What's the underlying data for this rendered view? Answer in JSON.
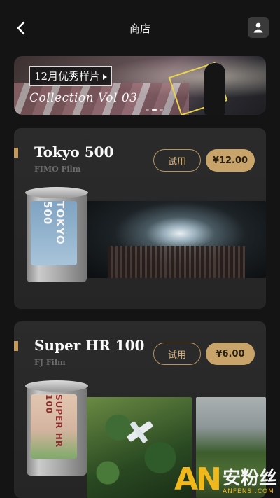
{
  "header": {
    "title": "商店"
  },
  "banner": {
    "tag": "12月优秀样片",
    "subtitle": "Collection Vol 03",
    "dots": 3,
    "active_dot": 1
  },
  "films": [
    {
      "name": "Tokyo 500",
      "brand": "FIMO Film",
      "try_label": "试用",
      "price": "¥12.00",
      "can_text": "TOKYO 500"
    },
    {
      "name": "Super HR 100",
      "brand": "FJ Film",
      "try_label": "试用",
      "price": "¥6.00",
      "can_text": "SUPER HR 100"
    }
  ],
  "watermark": {
    "logo": "AN",
    "cn": "安粉丝",
    "en": "ANFENSI.COM"
  },
  "colors": {
    "background": "#141414",
    "card": "#2b2b2b",
    "accent": "#c9a46a"
  }
}
